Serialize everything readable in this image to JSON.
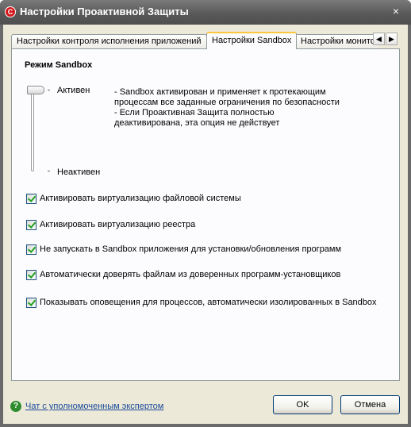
{
  "window": {
    "title": "Настройки Проактивной Защиты",
    "app_icon_glyph": "C",
    "close_glyph": "×"
  },
  "tabs": [
    {
      "label": "Настройки контроля исполнения приложений",
      "active": false
    },
    {
      "label": "Настройки Sandbox",
      "active": true
    },
    {
      "label": "Настройки монито",
      "active": false
    }
  ],
  "tab_scroll": {
    "left": "◀",
    "right": "▶"
  },
  "sandbox": {
    "section_title": "Режим Sandbox",
    "level_active": "Активен",
    "level_inactive": "Неактивен",
    "level_description": "- Sandbox активирован и применяет к протекающим\nпроцессам все заданные ограничения по безопасности\n- Если Проактивная Защита полностью\nдеактивирована, эта опция не действует"
  },
  "options": [
    {
      "label": "Активировать виртуализацию файловой системы",
      "checked": true
    },
    {
      "label": "Активировать виртуализацию реестра",
      "checked": true
    },
    {
      "label": "Не запускать в Sandbox приложения для установки/обновления программ",
      "checked": true
    },
    {
      "label": "Автоматически доверять файлам из доверенных программ-установщиков",
      "checked": true
    },
    {
      "label": "Показывать оповещения для процессов, автоматически изолированных в Sandbox",
      "checked": true
    }
  ],
  "footer": {
    "help_glyph": "?",
    "expert_link": "Чат с уполномоченным экспертом",
    "ok_label": "OK",
    "cancel_label": "Отмена"
  },
  "colors": {
    "accent": "#d4161b",
    "tab_highlight": "#ffc83c",
    "check": "#21a121"
  }
}
